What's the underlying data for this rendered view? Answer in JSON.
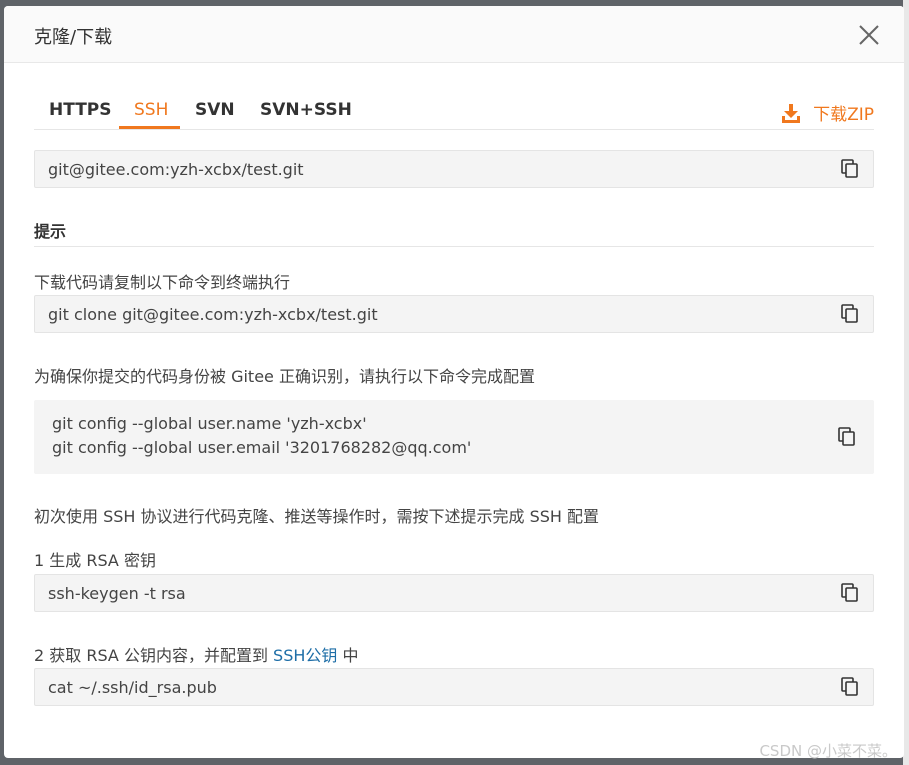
{
  "dialog": {
    "title": "克隆/下载"
  },
  "tabs": [
    {
      "label": "HTTPS"
    },
    {
      "label": "SSH"
    },
    {
      "label": "SVN"
    },
    {
      "label": "SVN+SSH"
    }
  ],
  "active_tab": "SSH",
  "download_zip": "下载ZIP",
  "ssh_url": "git@gitee.com:yzh-xcbx/test.git",
  "tips": {
    "heading": "提示",
    "clone_instruction": "下载代码请复制以下命令到终端执行",
    "clone_command": "git clone git@gitee.com:yzh-xcbx/test.git",
    "config_instruction": "为确保你提交的代码身份被 Gitee 正确识别，请执行以下命令完成配置",
    "config_lines": [
      "git config --global user.name 'yzh-xcbx'",
      "git config --global user.email '3201768282@qq.com'"
    ],
    "ssh_instruction": "初次使用 SSH 协议进行代码克隆、推送等操作时，需按下述提示完成 SSH 配置",
    "step1_label": "1 生成 RSA 密钥",
    "step1_command": "ssh-keygen -t rsa",
    "step2_prefix": "2 获取 RSA 公钥内容，并配置到 ",
    "step2_link": "SSH公钥",
    "step2_suffix": " 中",
    "step2_command": "cat ~/.ssh/id_rsa.pub"
  },
  "watermark": "CSDN @小菜不菜。",
  "colors": {
    "accent": "#f0781e",
    "link": "#1e6ea7",
    "code_bg": "#f4f4f4"
  },
  "icons": {
    "close": "close-icon",
    "download": "download-icon",
    "copy": "copy-icon"
  }
}
